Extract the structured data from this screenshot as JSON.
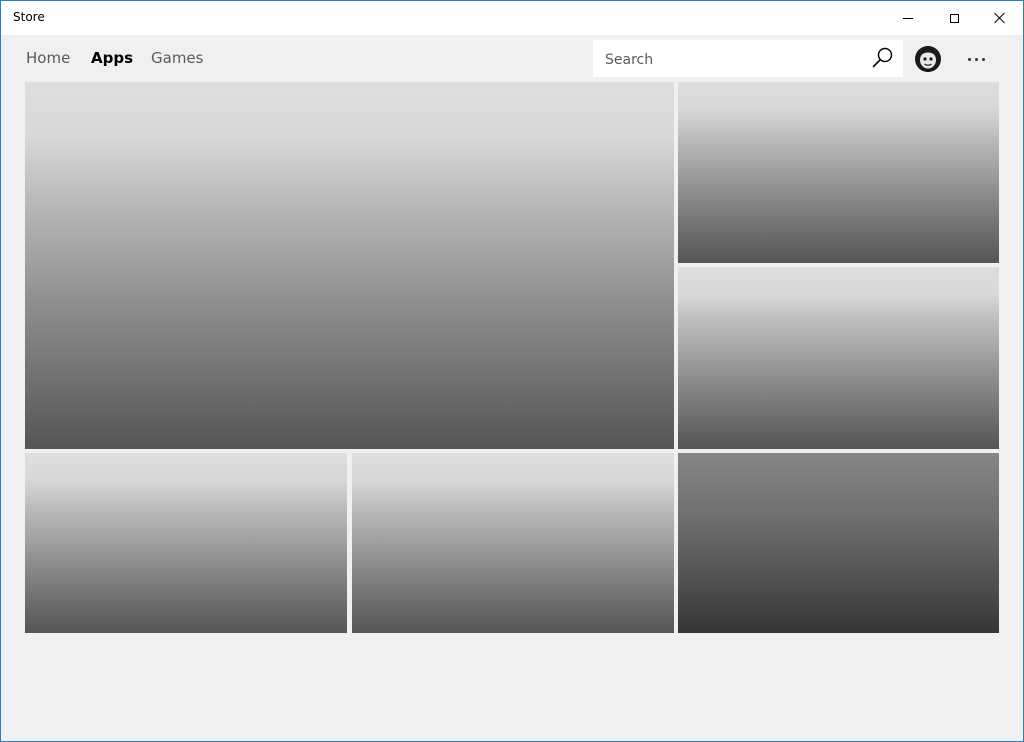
{
  "window": {
    "title": "Store"
  },
  "titlebar": {
    "buttons": {
      "minimize": "minimize-icon",
      "maximize": "maximize-icon",
      "close": "close-icon"
    }
  },
  "nav": {
    "tabs": [
      {
        "label": "Home",
        "selected": false
      },
      {
        "label": "Apps",
        "selected": true
      },
      {
        "label": "Games",
        "selected": false
      }
    ]
  },
  "search": {
    "placeholder": "Search",
    "value": "",
    "icon": "search-icon"
  },
  "account": {
    "icon": "avatar"
  },
  "more": {
    "icon": "more-icon"
  },
  "colors": {
    "window_border": "#2b7bc3",
    "background": "#f0f0f0",
    "tile_light_top": "#dedede",
    "tile_light_bottom": "#555555",
    "tile_dark_top": "#868686",
    "tile_dark_bottom": "#353535"
  },
  "tiles": [
    {
      "id": "hero",
      "style": "light"
    },
    {
      "id": "right-top",
      "style": "light"
    },
    {
      "id": "right-middle",
      "style": "light"
    },
    {
      "id": "bottom-left",
      "style": "light"
    },
    {
      "id": "bottom-middle",
      "style": "light"
    },
    {
      "id": "bottom-right",
      "style": "dark"
    }
  ]
}
